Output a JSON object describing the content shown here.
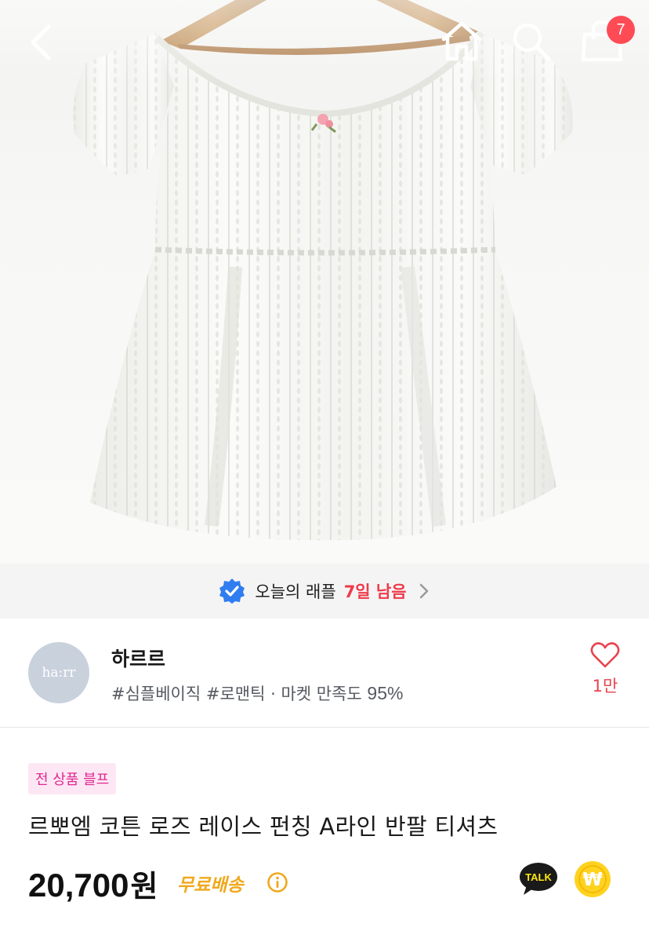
{
  "header": {
    "back_icon": "chevron-left-icon",
    "home_icon": "home-icon",
    "search_icon": "search-icon",
    "cart_icon": "shopping-bag-icon",
    "cart_count": "7"
  },
  "product_image": {
    "subject": "white lace punching off-shoulder short-sleeve top on wooden hanger"
  },
  "raffle": {
    "label": "오늘의 래플",
    "remaining": "7일 남음",
    "check_color": "#2f7df0"
  },
  "shop": {
    "avatar_text": "ha:rr",
    "name": "하르르",
    "tags": "#심플베이직 #로맨틱 · 마켓 만족도 ",
    "satisfaction": "95%",
    "follow_count": "1만"
  },
  "product": {
    "tag": "전 상품 블프",
    "title": "르뽀엠 코튼 로즈 레이스 펀칭 A라인 반팔 티셔츠",
    "price_number": "20,700",
    "price_unit": "원",
    "shipping": "무료배송",
    "talk_label": "TALK",
    "pay_symbol": "₩"
  },
  "colors": {
    "accent_red": "#ee3a4a",
    "shipping_orange": "#f0a81c",
    "tag_pink": "#e0288f",
    "badge_red": "#ff4b55"
  }
}
